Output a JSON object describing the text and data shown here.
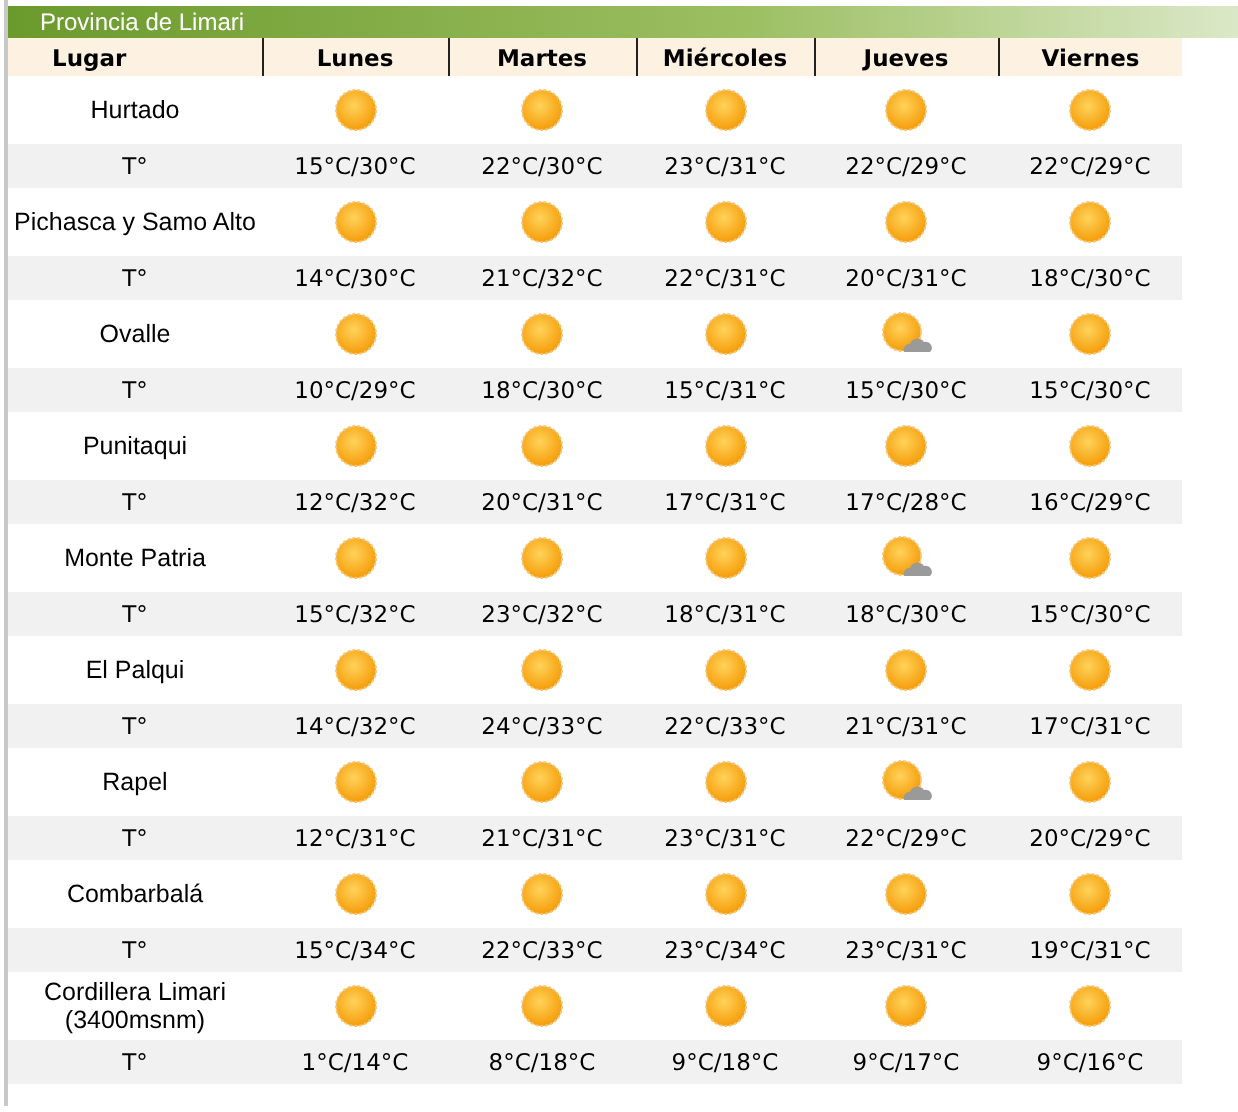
{
  "title": "Provincia de Limari",
  "columns": [
    "Lugar",
    "Lunes",
    "Martes",
    "Miércoles",
    "Jueves",
    "Viernes"
  ],
  "places": [
    {
      "name": "Hurtado",
      "temp_label": "T°",
      "days": [
        {
          "kind": "sunny",
          "temp": "15°C/30°C"
        },
        {
          "kind": "sunny",
          "temp": "22°C/30°C"
        },
        {
          "kind": "sunny",
          "temp": "23°C/31°C"
        },
        {
          "kind": "sunny",
          "temp": "22°C/29°C"
        },
        {
          "kind": "sunny",
          "temp": "22°C/29°C"
        }
      ]
    },
    {
      "name": "Pichasca y Samo Alto",
      "temp_label": "T°",
      "days": [
        {
          "kind": "sunny",
          "temp": "14°C/30°C"
        },
        {
          "kind": "sunny",
          "temp": "21°C/32°C"
        },
        {
          "kind": "sunny",
          "temp": "22°C/31°C"
        },
        {
          "kind": "sunny",
          "temp": "20°C/31°C"
        },
        {
          "kind": "sunny",
          "temp": "18°C/30°C"
        }
      ]
    },
    {
      "name": "Ovalle",
      "temp_label": "T°",
      "days": [
        {
          "kind": "sunny",
          "temp": "10°C/29°C"
        },
        {
          "kind": "sunny",
          "temp": "18°C/30°C"
        },
        {
          "kind": "sunny",
          "temp": "15°C/31°C"
        },
        {
          "kind": "partly_cloudy",
          "temp": "15°C/30°C"
        },
        {
          "kind": "sunny",
          "temp": "15°C/30°C"
        }
      ]
    },
    {
      "name": "Punitaqui",
      "temp_label": "T°",
      "days": [
        {
          "kind": "sunny",
          "temp": "12°C/32°C"
        },
        {
          "kind": "sunny",
          "temp": "20°C/31°C"
        },
        {
          "kind": "sunny",
          "temp": "17°C/31°C"
        },
        {
          "kind": "sunny",
          "temp": "17°C/28°C"
        },
        {
          "kind": "sunny",
          "temp": "16°C/29°C"
        }
      ]
    },
    {
      "name": "Monte Patria",
      "temp_label": "T°",
      "days": [
        {
          "kind": "sunny",
          "temp": "15°C/32°C"
        },
        {
          "kind": "sunny",
          "temp": "23°C/32°C"
        },
        {
          "kind": "sunny",
          "temp": "18°C/31°C"
        },
        {
          "kind": "partly_cloudy",
          "temp": "18°C/30°C"
        },
        {
          "kind": "sunny",
          "temp": "15°C/30°C"
        }
      ]
    },
    {
      "name": "El Palqui",
      "temp_label": "T°",
      "days": [
        {
          "kind": "sunny",
          "temp": "14°C/32°C"
        },
        {
          "kind": "sunny",
          "temp": "24°C/33°C"
        },
        {
          "kind": "sunny",
          "temp": "22°C/33°C"
        },
        {
          "kind": "sunny",
          "temp": "21°C/31°C"
        },
        {
          "kind": "sunny",
          "temp": "17°C/31°C"
        }
      ]
    },
    {
      "name": "Rapel",
      "temp_label": "T°",
      "days": [
        {
          "kind": "sunny",
          "temp": "12°C/31°C"
        },
        {
          "kind": "sunny",
          "temp": "21°C/31°C"
        },
        {
          "kind": "sunny",
          "temp": "23°C/31°C"
        },
        {
          "kind": "partly_cloudy",
          "temp": "22°C/29°C"
        },
        {
          "kind": "sunny",
          "temp": "20°C/29°C"
        }
      ]
    },
    {
      "name": "Combarbalá",
      "temp_label": "T°",
      "days": [
        {
          "kind": "sunny",
          "temp": "15°C/34°C"
        },
        {
          "kind": "sunny",
          "temp": "22°C/33°C"
        },
        {
          "kind": "sunny",
          "temp": "23°C/34°C"
        },
        {
          "kind": "sunny",
          "temp": "23°C/31°C"
        },
        {
          "kind": "sunny",
          "temp": "19°C/31°C"
        }
      ]
    },
    {
      "name": "Cordillera Limari (3400msnm)",
      "temp_label": "T°",
      "days": [
        {
          "kind": "sunny",
          "temp": "1°C/14°C"
        },
        {
          "kind": "sunny",
          "temp": "8°C/18°C"
        },
        {
          "kind": "sunny",
          "temp": "9°C/18°C"
        },
        {
          "kind": "sunny",
          "temp": "9°C/17°C"
        },
        {
          "kind": "sunny",
          "temp": "9°C/16°C"
        }
      ]
    }
  ]
}
